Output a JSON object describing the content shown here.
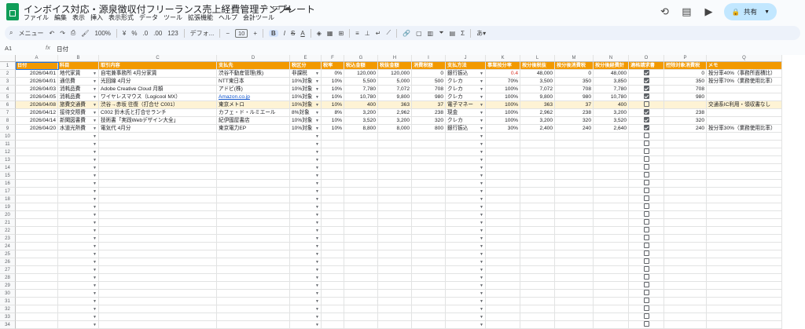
{
  "doc": {
    "title": "インボイス対応・源泉徴収付フリーランス売上経費管理テンプレート",
    "menus": [
      "ファイル",
      "編集",
      "表示",
      "挿入",
      "表示形式",
      "データ",
      "ツール",
      "拡張機能",
      "ヘルプ",
      "会計ツール"
    ],
    "share_label": "共有"
  },
  "toolbar": {
    "menu_label": "メニュー",
    "zoom": "100%",
    "currency": "¥",
    "percent": "%",
    "decimal_dec": ".0",
    "decimal_inc": ".00",
    "number_format": "123",
    "font": "デフォ...",
    "font_size": "10"
  },
  "formula_bar": {
    "cell_ref": "A1",
    "fx": "fx",
    "value": "日付"
  },
  "columns": [
    "A",
    "B",
    "C",
    "D",
    "E",
    "F",
    "G",
    "H",
    "I",
    "J",
    "K",
    "L",
    "M",
    "N",
    "O",
    "P",
    "Q"
  ],
  "headers": [
    "日付",
    "科目",
    "取引内容",
    "支払先",
    "税区分",
    "税率",
    "税込金額",
    "税抜金額",
    "消費税額",
    "支払方法",
    "事業按分率",
    "按分後税抜",
    "按分後消費税",
    "按分後経費計",
    "適格請求書",
    "控除対象消費税",
    "メモ"
  ],
  "rows": [
    {
      "num": "2",
      "date": "2026/04/01",
      "account": "地代家賃",
      "desc": "自宅兼事務所 4月分家賃",
      "payee": "渋谷不動産管理(株)",
      "tax_class": "非課税",
      "rate": "0%",
      "incl": "120,000",
      "excl": "120,000",
      "tax": "0",
      "method": "銀行振込",
      "ratio": "0.4",
      "alloc_excl": "48,000",
      "alloc_tax": "0",
      "alloc_total": "48,000",
      "invoice": true,
      "deduct": "0",
      "memo": "按分率40%（事務所面積比）"
    },
    {
      "num": "3",
      "date": "2026/04/01",
      "account": "通信費",
      "desc": "光回線 4月分",
      "payee": "NTT東日本",
      "tax_class": "10%対象",
      "rate": "10%",
      "incl": "5,500",
      "excl": "5,000",
      "tax": "500",
      "method": "クレカ",
      "ratio": "70%",
      "alloc_excl": "3,500",
      "alloc_tax": "350",
      "alloc_total": "3,850",
      "invoice": true,
      "deduct": "350",
      "memo": "按分率70%（業務使用比率）"
    },
    {
      "num": "4",
      "date": "2026/04/03",
      "account": "消耗品費",
      "desc": "Adobe Creative Cloud 月額",
      "payee": "アドビ(株)",
      "tax_class": "10%対象",
      "rate": "10%",
      "incl": "7,780",
      "excl": "7,072",
      "tax": "708",
      "method": "クレカ",
      "ratio": "100%",
      "alloc_excl": "7,072",
      "alloc_tax": "708",
      "alloc_total": "7,780",
      "invoice": true,
      "deduct": "708",
      "memo": ""
    },
    {
      "num": "5",
      "date": "2026/04/05",
      "account": "消耗品費",
      "desc": "ワイヤレスマウス（Logicool MX）",
      "payee": "Amazon.co.jp",
      "tax_class": "10%対象",
      "rate": "10%",
      "incl": "10,780",
      "excl": "9,800",
      "tax": "980",
      "method": "クレカ",
      "ratio": "100%",
      "alloc_excl": "9,800",
      "alloc_tax": "980",
      "alloc_total": "10,780",
      "invoice": true,
      "deduct": "980",
      "memo": ""
    },
    {
      "num": "6",
      "date": "2026/04/08",
      "account": "旅費交通費",
      "desc": "渋谷→赤坂 往復（打合せ C001）",
      "payee": "東京メトロ",
      "tax_class": "10%対象",
      "rate": "10%",
      "incl": "400",
      "excl": "363",
      "tax": "37",
      "method": "電子マネー",
      "ratio": "100%",
      "alloc_excl": "363",
      "alloc_tax": "37",
      "alloc_total": "400",
      "invoice": false,
      "deduct": "",
      "memo": "交通系IC利用・領収書なし"
    },
    {
      "num": "7",
      "date": "2026/04/12",
      "account": "接待交際費",
      "desc": "C002 鈴木氏と打合せランチ",
      "payee": "カフェ・ド・ルミエール",
      "tax_class": "8%対象",
      "rate": "8%",
      "incl": "3,200",
      "excl": "2,962",
      "tax": "238",
      "method": "現金",
      "ratio": "100%",
      "alloc_excl": "2,962",
      "alloc_tax": "238",
      "alloc_total": "3,200",
      "invoice": true,
      "deduct": "238",
      "memo": ""
    },
    {
      "num": "8",
      "date": "2026/04/14",
      "account": "新聞図書費",
      "desc": "技術書「実践Webデザイン大全」",
      "payee": "紀伊國屋書店",
      "tax_class": "10%対象",
      "rate": "10%",
      "incl": "3,520",
      "excl": "3,200",
      "tax": "320",
      "method": "クレカ",
      "ratio": "100%",
      "alloc_excl": "3,200",
      "alloc_tax": "320",
      "alloc_total": "3,520",
      "invoice": true,
      "deduct": "320",
      "memo": ""
    },
    {
      "num": "9",
      "date": "2026/04/20",
      "account": "水道光熱費",
      "desc": "電気代 4月分",
      "payee": "東京電力EP",
      "tax_class": "10%対象",
      "rate": "10%",
      "incl": "8,800",
      "excl": "8,000",
      "tax": "800",
      "method": "銀行振込",
      "ratio": "30%",
      "alloc_excl": "2,400",
      "alloc_tax": "240",
      "alloc_total": "2,640",
      "invoice": true,
      "deduct": "240",
      "memo": "按分率30%（業務使用比率）"
    }
  ],
  "empty_rows": [
    "10",
    "11",
    "12",
    "13",
    "14",
    "15",
    "16",
    "17",
    "18",
    "19",
    "20",
    "21",
    "22",
    "23",
    "24",
    "25",
    "26",
    "27",
    "28",
    "29",
    "30",
    "31",
    "32",
    "33",
    "34"
  ],
  "icons": {
    "history": "history-icon",
    "comment": "comment-icon",
    "meet": "video-icon",
    "share": "lock-icon"
  },
  "colors": {
    "header_orange": "#f29900",
    "highlight_row": "#fef3d5",
    "share_bg": "#c2e7ff",
    "sheets_green": "#0f9d58"
  }
}
